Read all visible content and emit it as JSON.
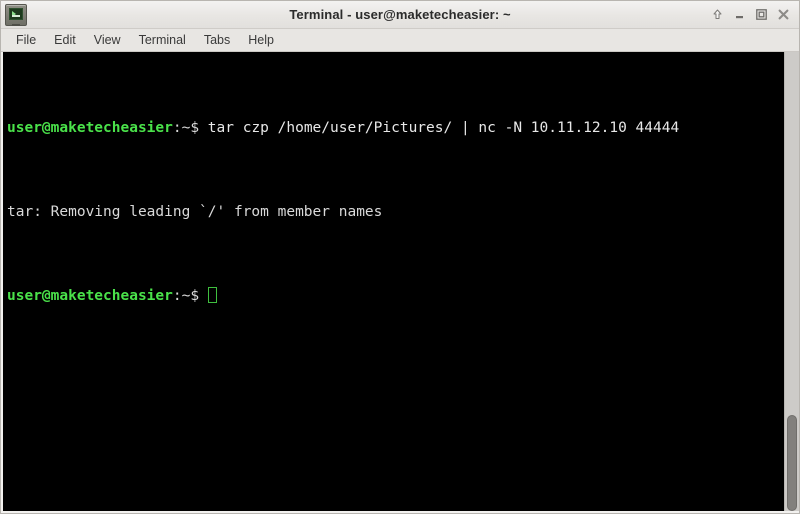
{
  "window": {
    "title": "Terminal - user@maketecheasier: ~",
    "icon_name": "terminal-app-icon"
  },
  "titlebar_buttons": [
    {
      "name": "shade-button",
      "icon": "up-arrow-icon",
      "label": "Shade"
    },
    {
      "name": "minimize-button",
      "icon": "minimize-icon",
      "label": "Minimize"
    },
    {
      "name": "maximize-button",
      "icon": "maximize-icon",
      "label": "Maximize"
    },
    {
      "name": "close-button",
      "icon": "close-icon",
      "label": "Close"
    }
  ],
  "menubar": {
    "items": [
      {
        "label": "File"
      },
      {
        "label": "Edit"
      },
      {
        "label": "View"
      },
      {
        "label": "Terminal"
      },
      {
        "label": "Tabs"
      },
      {
        "label": "Help"
      }
    ]
  },
  "terminal": {
    "background": "#000000",
    "prompt_color": "#4ae24a",
    "text_color": "#d9d9d9",
    "cursor_color": "#3fbf3f",
    "lines": [
      {
        "type": "command",
        "prompt_user": "user@maketecheasier",
        "prompt_tail": ":~$ ",
        "command": "tar czp /home/user/Pictures/ | nc -N 10.11.12.10 44444"
      },
      {
        "type": "output",
        "text": "tar: Removing leading `/' from member names"
      },
      {
        "type": "prompt",
        "prompt_user": "user@maketecheasier",
        "prompt_tail": ":~$ "
      }
    ]
  },
  "scrollbar": {
    "thumb_top_pct": 79,
    "thumb_height_pct": 21
  }
}
